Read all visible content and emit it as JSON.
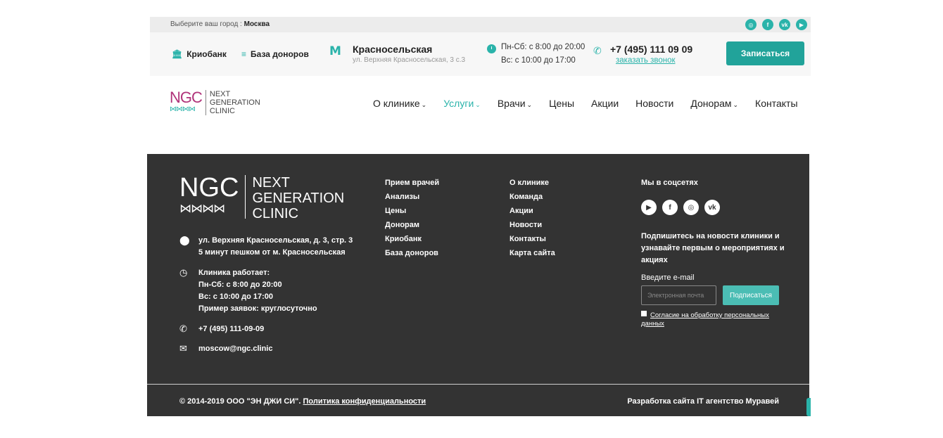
{
  "topbar": {
    "city_prompt": "Выберите ваш город :",
    "city": "Москва",
    "socials": [
      "instagram-icon",
      "facebook-icon",
      "vk-icon",
      "youtube-icon"
    ]
  },
  "infobar": {
    "cryobank": "Криобанк",
    "donor_base": "База доноров",
    "metro_station": "Красносельская",
    "metro_address": "ул. Верхняя Красносельская, 3 с.3",
    "hours_weekdays": "Пн-Сб: с 8:00 до 20:00",
    "hours_sunday": "Вс: с 10:00 до 17:00",
    "phone": "+7 (495) 111 09 09",
    "callback": "заказать звонок",
    "signup": "Записаться"
  },
  "logo": {
    "abbr": "NGC",
    "line1": "NEXT",
    "line2": "GENERATION",
    "line3": "CLINIC"
  },
  "nav": {
    "about": "О клинике",
    "services": "Услуги",
    "doctors": "Врачи",
    "prices": "Цены",
    "promos": "Акции",
    "news": "Новости",
    "donors": "Донорам",
    "contacts": "Контакты"
  },
  "footer": {
    "address1": "ул. Верхняя Красносельская, д. 3, стр. 3",
    "address2": "5 минут пешком от м. Красносельская",
    "hours_title": "Клиника работает:",
    "hours1": "Пн-Сб: с 8:00 до 20:00",
    "hours2": "Вс: с 10:00 до 17:00",
    "hours3": "Пример заявок: круглосуточно",
    "phone": "+7 (495) 111-09-09",
    "email": "moscow@ngc.clinic",
    "col1": [
      "Прием врачей",
      "Анализы",
      "Цены",
      "Донорам",
      "Криобанк",
      "База доноров"
    ],
    "col2": [
      "О клинике",
      "Команда",
      "Акции",
      "Новости",
      "Контакты",
      "Карта сайта"
    ],
    "social_title": "Мы в соцсетях",
    "socials": [
      "youtube-icon",
      "facebook-icon",
      "instagram-icon",
      "vk-icon"
    ],
    "subscribe_text": "Подпишитесь на новости клиники и узнавайте первым о мероприятиях и акциях",
    "email_label": "Введите e-mail",
    "email_placeholder": "Электронная почта",
    "subscribe_btn": "Подписаться",
    "consent": "Согласие на обработку персональных данных",
    "copyright": "© 2014-2019 ООО \"ЭН ДЖИ СИ\".",
    "privacy": "Политика конфиденциальности",
    "developer": "Разработка сайта IT агентство Муравей"
  }
}
